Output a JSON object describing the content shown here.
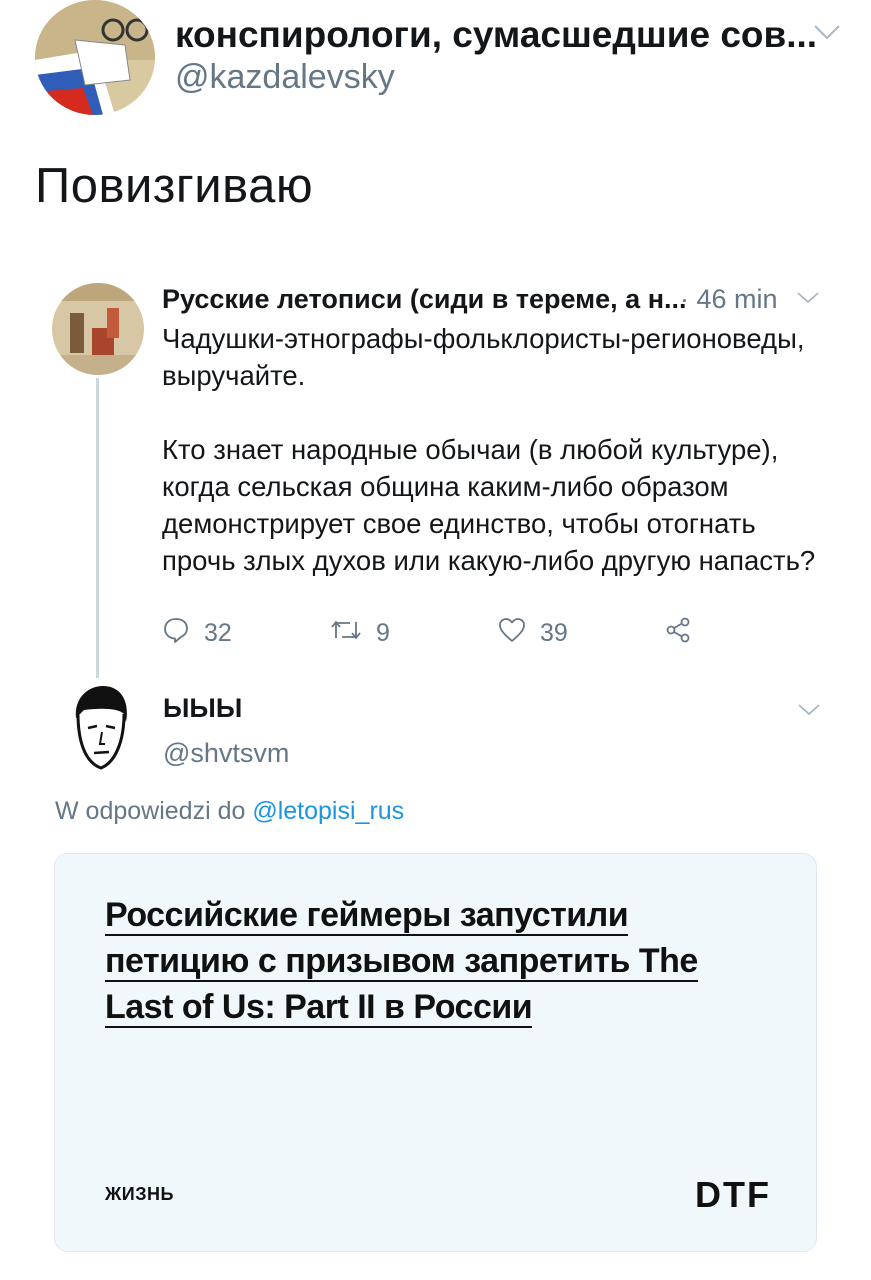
{
  "main_tweet": {
    "author_name": "конспирологи, сумасшедшие сов...",
    "author_handle": "@kazdalevsky",
    "text": "Повизгиваю"
  },
  "quoted_tweet": {
    "author_name": "Русские летописи (сиди в тереме, а н...",
    "time": "· 46 min",
    "paragraph1": "Чадушки-этнографы-фольклористы-регионоведы, выручайте.",
    "paragraph2": "Кто знает народные обычаи (в любой культуре), когда сельская община каким-либо образом демонстрирует свое единство, чтобы отогнать прочь злых духов или какую-либо другую напасть?",
    "actions": {
      "replies": "32",
      "retweets": "9",
      "likes": "39"
    }
  },
  "reply": {
    "author_name": "ЫЫЫ",
    "author_handle": "@shvtsvm",
    "reply_to_prefix": "W odpowiedzi do",
    "reply_to_handle": "@letopisi_rus"
  },
  "card": {
    "title": "Российские геймеры запустили петицию с призывом запретить The Last of Us: Part II в России",
    "tag": "ЖИЗНЬ",
    "brand": "DTF"
  },
  "colors": {
    "text": "#14171a",
    "secondary": "#657786",
    "link": "#1b95e0",
    "card_bg": "#f1f8fc"
  },
  "icons": [
    "chevron-down-icon",
    "reply-icon",
    "retweet-icon",
    "like-icon",
    "share-icon"
  ]
}
